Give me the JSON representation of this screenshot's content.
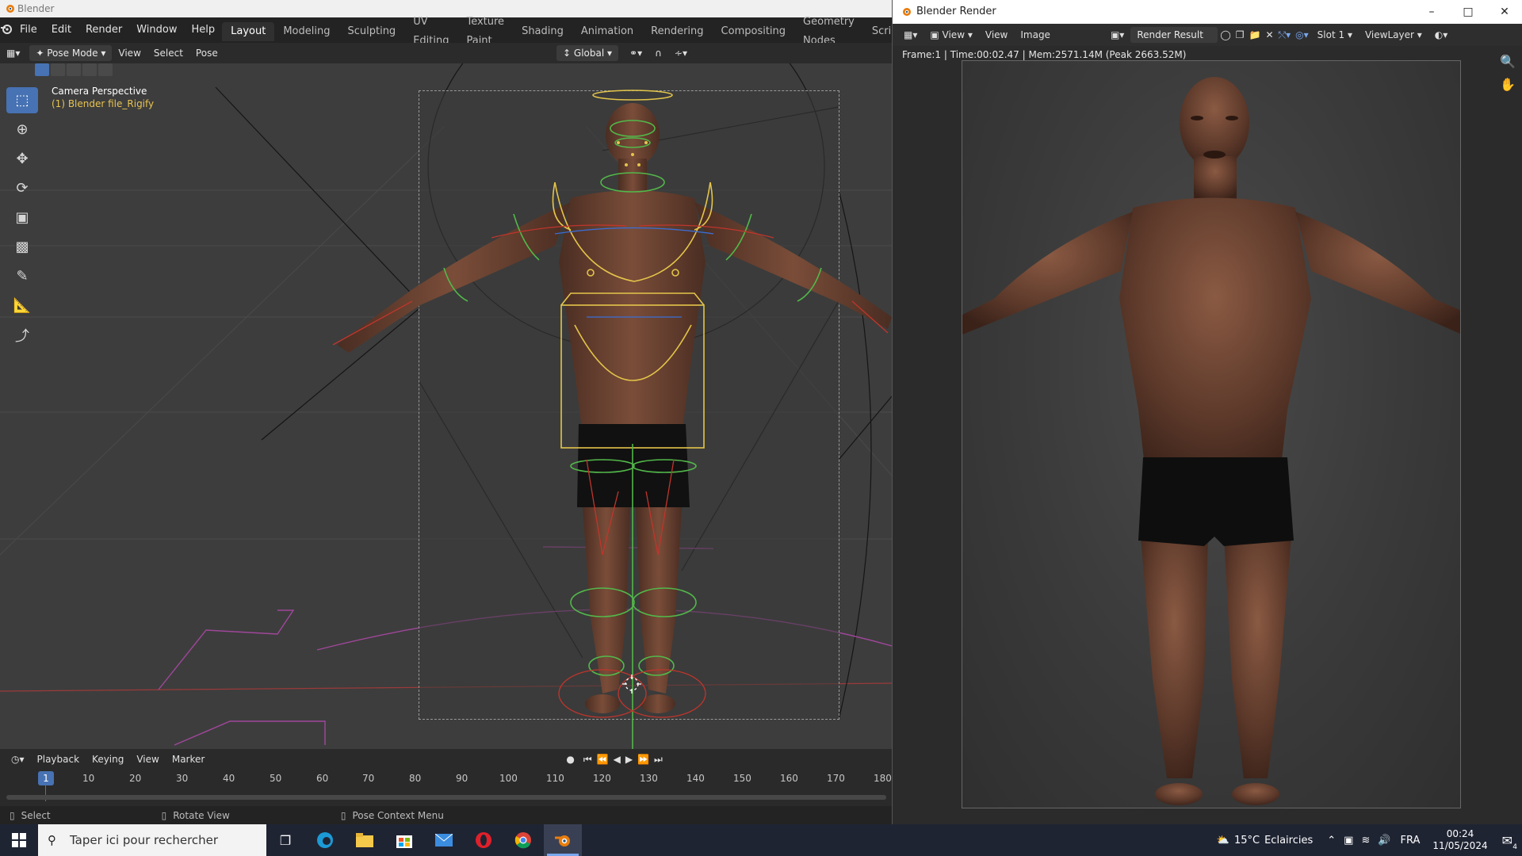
{
  "window": {
    "title": "Blender"
  },
  "topbar": {
    "menus": [
      "File",
      "Edit",
      "Render",
      "Window",
      "Help"
    ],
    "workspaces": [
      "Layout",
      "Modeling",
      "Sculpting",
      "UV Editing",
      "Texture Paint",
      "Shading",
      "Animation",
      "Rendering",
      "Compositing",
      "Geometry Nodes",
      "Scripting"
    ],
    "add_tab": "+"
  },
  "header": {
    "mode": "Pose Mode",
    "menus": [
      "View",
      "Select",
      "Pose"
    ],
    "orientation": "Global"
  },
  "viewport": {
    "view_name": "Camera Perspective",
    "object_name": "(1) Blender file_Rigify"
  },
  "timeline": {
    "menus": [
      "Playback",
      "Keying",
      "View",
      "Marker"
    ],
    "current_frame": "1",
    "frames": [
      "10",
      "20",
      "30",
      "40",
      "50",
      "60",
      "70",
      "80",
      "90",
      "100",
      "110",
      "120",
      "130",
      "140",
      "150",
      "160",
      "170",
      "180"
    ]
  },
  "statusbar": {
    "select": "Select",
    "rotate": "Rotate View",
    "context": "Pose Context Menu"
  },
  "render_window": {
    "title": "Blender Render",
    "menus": [
      "View",
      "View",
      "Image"
    ],
    "image_name": "Render Result",
    "slot": "Slot 1",
    "view_layer": "ViewLayer",
    "stats": "Frame:1 | Time:00:02.47 | Mem:2571.14M (Peak 2663.52M)"
  },
  "taskbar": {
    "search_placeholder": "Taper ici pour rechercher",
    "weather_temp": "15°C",
    "weather_text": "Eclaircies",
    "language": "FRA",
    "time": "00:24",
    "date": "11/05/2024",
    "notifications": "4"
  },
  "colors": {
    "accent": "#4772b3",
    "rig_yellow": "#e4c54a",
    "rig_green": "#52b84a",
    "rig_red": "#c0352c",
    "skin": "#6b4433"
  }
}
